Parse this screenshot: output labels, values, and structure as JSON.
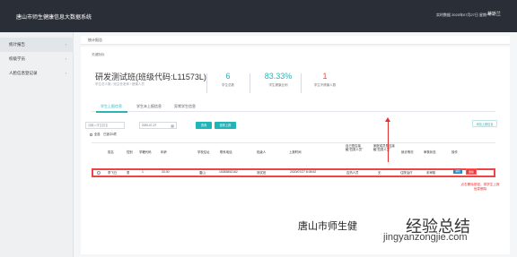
{
  "app": {
    "title": "唐山市师生健康信息大数据系统",
    "top_status": "实时数据 2020年07月27日 星期一",
    "user": "蒂斯兰"
  },
  "sidebar": {
    "items": [
      {
        "label": "统计报告"
      },
      {
        "label": "校级学员"
      },
      {
        "label": "人脸信息登记录"
      }
    ]
  },
  "tabs": {
    "items": [
      {
        "label": "统计报告"
      }
    ]
  },
  "page": {
    "breadcrumb": "关键指标",
    "class_name": "研发测试班(班级代码:L11573L)",
    "class_sub": "学生总人数 / 班主任老师 / 授课人员",
    "metrics": [
      {
        "value": "6",
        "label": "学生总数"
      },
      {
        "value": "83.33%",
        "label": "学生健康比例"
      },
      {
        "value": "1",
        "label": "学生不健康人数"
      }
    ]
  },
  "subtabs": {
    "items": [
      {
        "label": "学生上报信息"
      },
      {
        "label": "学生未上报信息"
      },
      {
        "label": "异常学生信息"
      }
    ]
  },
  "filters": {
    "search_placeholder": "请输入学生姓名",
    "date_value": "2020-07-27",
    "search_button": "查询",
    "view_button": "查看上报",
    "add_button": "添加上报信息",
    "selection_text": "全选",
    "selection_count": "已选中0项"
  },
  "table": {
    "headers": [
      "姓名",
      "性别",
      "学籍代码",
      "年龄",
      "学校住址",
      "联系电话",
      "班级人",
      "上报时间",
      "自己是否接触\"四类人员\"",
      "家庭成员是否接触\"四类人员\"",
      "就诊情况",
      "审核状态",
      "操作"
    ],
    "rows": [
      {
        "name": "李飞日",
        "gender": "男",
        "code": "1",
        "age": "33.00",
        "address": "唐山",
        "phone": "15383852162",
        "class_person": "测试班",
        "reported_at": "2020/07/27 8:08:52",
        "self_contact": "否热人员",
        "family_contact": "无",
        "medical": "住院治疗",
        "status": "未审核",
        "edit_label": "编辑",
        "delete_label": "删除"
      }
    ]
  },
  "annotation": {
    "text": "点击删除按钮，将学生上报信息删除"
  },
  "watermark": {
    "left_text": "唐山市师生健",
    "site_name": "经验总结",
    "url": "jingyanzongjie.com"
  },
  "colors": {
    "accent": "#2bb4b8",
    "danger": "#e53d3d",
    "topbar": "#2a2f37"
  }
}
